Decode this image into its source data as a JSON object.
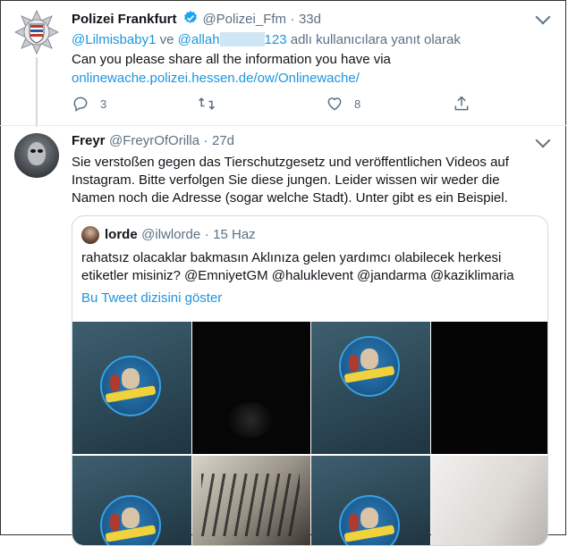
{
  "tweet1": {
    "name": "Polizei Frankfurt",
    "handle": "@Polizei_Ffm",
    "sep": "·",
    "time": "33d",
    "reply_prefix_user1": "@Lilmisbaby1",
    "reply_and": "ve",
    "reply_prefix_user2": "@allah",
    "reply_prefix_user2_tail": "123",
    "reply_suffix": "adlı kullanıcılara yanıt olarak",
    "body": "Can you please share all the information you have via",
    "link": "onlinewache.polizei.hessen.de/ow/Onlinewache/",
    "reply_count": "3",
    "like_count": "8"
  },
  "tweet2": {
    "name": "Freyr",
    "handle": "@FreyrOfOrilla",
    "sep": "·",
    "time": "27d",
    "body_line1": "Sie verstoßen gegen das Tierschutzgesetz und veröffentlichen Videos auf",
    "body_line2": "Instagram. Bitte verfolgen Sie diese jungen. Leider wissen wir weder die",
    "body_line3": "Namen noch die Adresse (sogar welche Stadt). Unter gibt es ein Beispiel."
  },
  "quoted": {
    "name": "lorde",
    "handle": "@ilwlorde",
    "sep": "·",
    "time": "15 Haz",
    "body_line1": "rahatsız olacaklar bakmasın Aklınıza gelen yardımcı olabilecek herkesi",
    "body_line2": "etiketler misiniz? @EmniyetGM @haluklevent @jandarma @kaziklimaria",
    "thread_link": "Bu Tweet dizisini göster"
  },
  "colors": {
    "accent": "#1b95e0",
    "verified": "#1da1f2",
    "muted": "#5b7083"
  },
  "icons": [
    "police-star-icon",
    "verified-badge-icon",
    "reply-icon",
    "retweet-icon",
    "like-icon",
    "share-icon",
    "chevron-down-icon"
  ]
}
